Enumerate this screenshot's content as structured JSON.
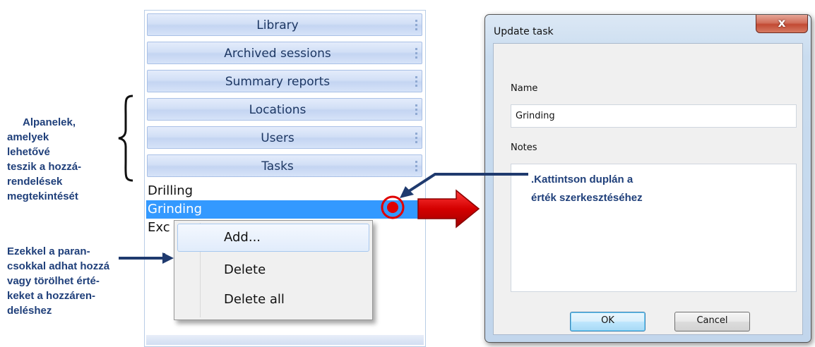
{
  "left_panel": {
    "headers": [
      {
        "label": "Library"
      },
      {
        "label": "Archived sessions"
      },
      {
        "label": "Summary reports"
      },
      {
        "label": "Locations"
      },
      {
        "label": "Users"
      },
      {
        "label": "Tasks"
      }
    ],
    "tasks": [
      {
        "label": "Drilling",
        "selected": false
      },
      {
        "label": "Grinding",
        "selected": true
      },
      {
        "label": "Exc",
        "selected": false
      }
    ]
  },
  "context_menu": {
    "items": [
      {
        "label": "Add...",
        "highlighted": true
      },
      {
        "label": "Delete",
        "highlighted": false
      },
      {
        "label": "Delete all",
        "highlighted": false
      }
    ]
  },
  "dialog": {
    "title": "Update task",
    "close_glyph": "x",
    "name_label": "Name",
    "name_value": "Grinding",
    "notes_label": "Notes",
    "notes_value": "",
    "ok_label": "OK",
    "cancel_label": "Cancel"
  },
  "annotations": {
    "subpanels": [
      "Alpanelek,",
      "amelyek",
      "lehetővé",
      "teszik a hozzá-",
      "rendelések",
      "megtekintését"
    ],
    "commands": [
      "Ezekkel a paran-",
      "csokkal adhat hozzá",
      "vagy törölhet érté-",
      "keket a hozzáren-",
      "deléshez"
    ],
    "callout": [
      ".Kattintson duplán a",
      "érték szerkesztéséhez"
    ]
  },
  "colors": {
    "selection": "#3399ff",
    "annotation_text": "#1f3f7a",
    "pointer_arrow": "#cc0000",
    "callout_arrow": "#1f3a6e"
  }
}
